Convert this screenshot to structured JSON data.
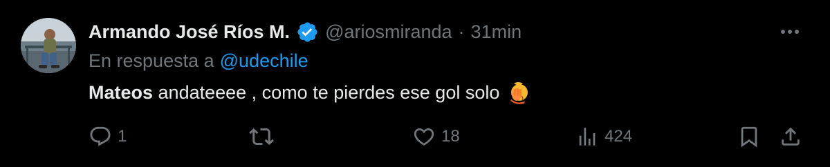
{
  "author": {
    "display_name": "Armando José Ríos M.",
    "handle": "@ariosmiranda",
    "separator": "·",
    "timestamp": "31min",
    "verified_icon": "verified-badge-icon"
  },
  "reply": {
    "prefix": "En respuesta a",
    "mention": "@udechile"
  },
  "content": {
    "bold": "Mateos",
    "text": " andateeee , como te pierdes ese gol solo",
    "emoji": "face-palm-emoji"
  },
  "actions": {
    "reply_count": "1",
    "retweet_count": "",
    "like_count": "18",
    "views_count": "424"
  },
  "colors": {
    "background": "#000000",
    "text_primary": "#e7e9ea",
    "text_secondary": "#71767b",
    "accent": "#1d9bf0"
  }
}
